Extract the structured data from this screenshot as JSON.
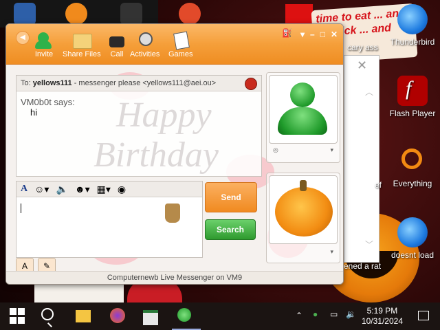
{
  "desktop": {
    "icons": [
      {
        "label": "Thunderbird",
        "kind": "thunderbird"
      },
      {
        "label": "Flash Player",
        "kind": "flash"
      },
      {
        "label": "Everything",
        "kind": "everything"
      },
      {
        "label": "doesnt load",
        "kind": "thunderbird"
      }
    ],
    "partial_labels": [
      "cary ass",
      "ef",
      "ened a rat"
    ],
    "wallpaper_sign": "time to eat ... and go trick ... and vote!"
  },
  "messenger": {
    "toolbar": [
      {
        "label": "Invite",
        "icon": "invite-icon"
      },
      {
        "label": "Share Files",
        "icon": "folder-icon"
      },
      {
        "label": "Call",
        "icon": "phone-icon"
      },
      {
        "label": "Activities",
        "icon": "activities-icon"
      },
      {
        "label": "Games",
        "icon": "games-icon"
      }
    ],
    "to_prefix": "To:",
    "to_name": "yellows111",
    "to_detail": "- messenger please <yellows111@aei.ou>",
    "sender_line": "VM0b0t says:",
    "message": "hi",
    "watermark_1": "Happy",
    "watermark_2": "Birthday",
    "send_label": "Send",
    "search_label": "Search",
    "format_a": "A",
    "status": "Computernewb Live Messenger on VM9"
  },
  "taskbar": {
    "time": "5:19 PM",
    "date": "10/31/2024"
  }
}
